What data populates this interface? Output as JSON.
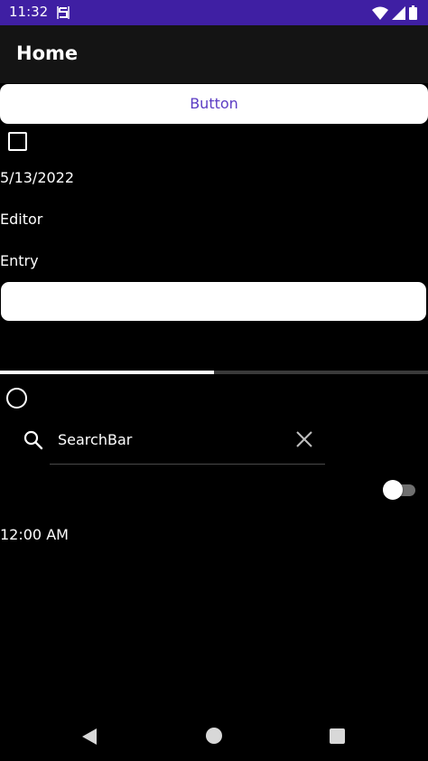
{
  "status_bar": {
    "time": "11:32",
    "color": "#3f1fa3",
    "icons": [
      "s-notification-icon",
      "wifi-icon",
      "cellular-signal-icon",
      "battery-icon"
    ]
  },
  "app_bar": {
    "title": "Home"
  },
  "controls": {
    "button_label": "Button",
    "checkbox_checked": false,
    "date_value": "5/13/2022",
    "editor_label": "Editor",
    "entry_label": "Entry",
    "entry_value": "",
    "progress": 0.5,
    "radio_selected": false,
    "search": {
      "text": "SearchBar",
      "icons": [
        "search-icon",
        "clear-icon"
      ]
    },
    "switch_on": false,
    "time_value": "12:00 AM"
  },
  "nav_bar": {
    "icons": [
      "back-icon",
      "home-icon",
      "recents-icon"
    ]
  },
  "colors": {
    "accent": "#5b3cc4",
    "background": "#000000",
    "app_bar": "#141414"
  }
}
